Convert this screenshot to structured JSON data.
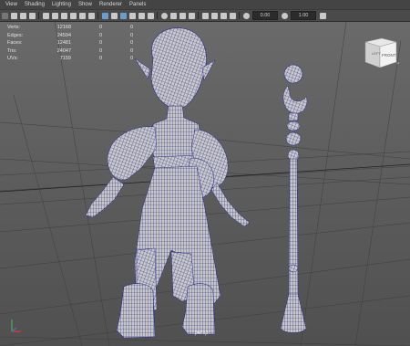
{
  "menu": [
    "View",
    "Shading",
    "Lighting",
    "Show",
    "Renderer",
    "Panels"
  ],
  "toolbar": {
    "field1_value": "0.00",
    "field2_value": "1.00"
  },
  "hud": {
    "rows": [
      {
        "label": "Verts:",
        "v1": "12168",
        "v2": "0",
        "v3": "0"
      },
      {
        "label": "Edges:",
        "v1": "24594",
        "v2": "0",
        "v3": "0"
      },
      {
        "label": "Faces:",
        "v1": "12481",
        "v2": "0",
        "v3": "0"
      },
      {
        "label": "Tris:",
        "v1": "24047",
        "v2": "0",
        "v3": "0"
      },
      {
        "label": "UVs:",
        "v1": "7159",
        "v2": "0",
        "v3": "0"
      }
    ]
  },
  "viewcube": {
    "front_label": "FRONT",
    "left_label": "LEFT"
  },
  "camera_label": "persp",
  "colors": {
    "wireframe": "#2a2a8c",
    "mesh_fill": "#c7c7c7",
    "viewport_bg": "#5f5f5f"
  }
}
